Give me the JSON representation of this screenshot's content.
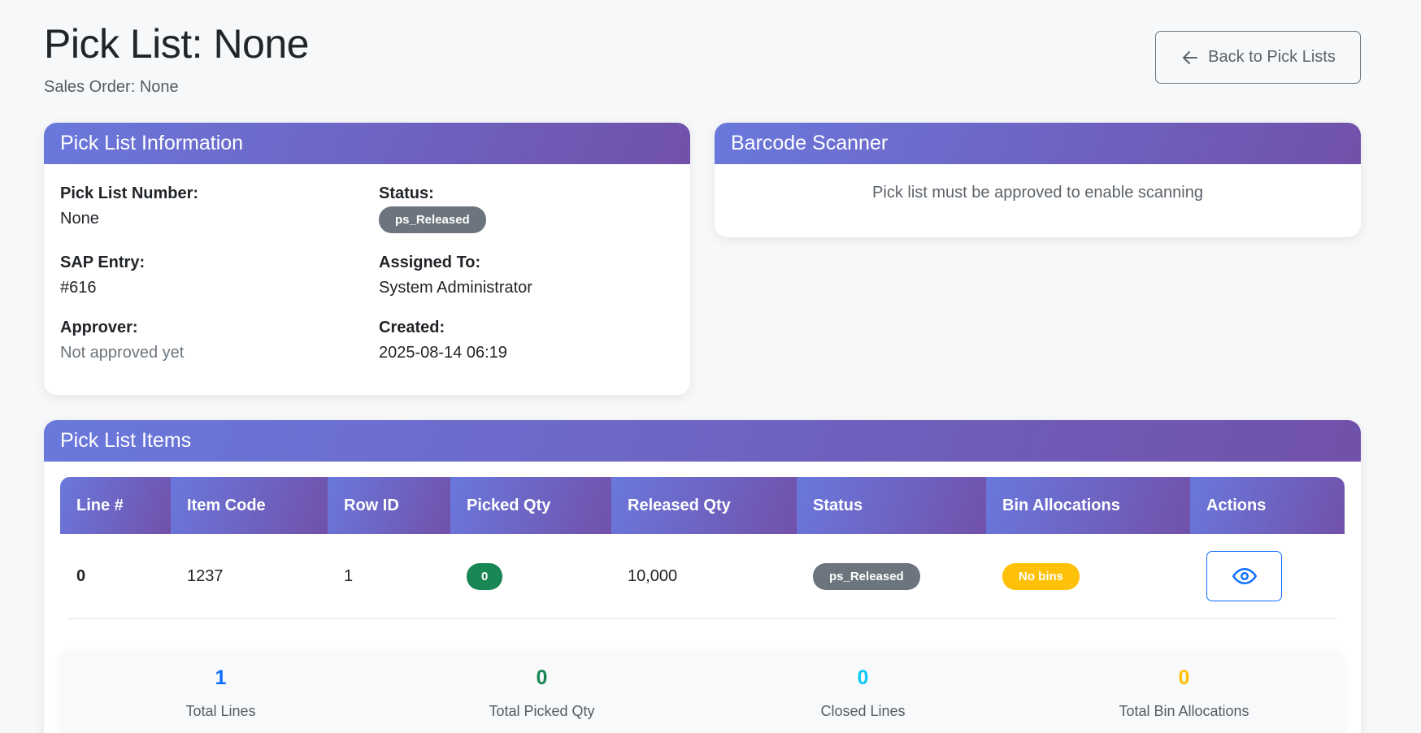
{
  "header": {
    "title": "Pick List: None",
    "subtitle": "Sales Order: None",
    "back_label": "Back to Pick Lists"
  },
  "info_card": {
    "title": "Pick List Information",
    "fields": {
      "pick_list_number": {
        "label": "Pick List Number:",
        "value": "None"
      },
      "status": {
        "label": "Status:",
        "value": "ps_Released"
      },
      "sap_entry": {
        "label": "SAP Entry:",
        "value": "#616"
      },
      "assigned_to": {
        "label": "Assigned To:",
        "value": "System Administrator"
      },
      "approver": {
        "label": "Approver:",
        "value": "Not approved yet"
      },
      "created": {
        "label": "Created:",
        "value": "2025-08-14 06:19"
      }
    }
  },
  "scanner_card": {
    "title": "Barcode Scanner",
    "message": "Pick list must be approved to enable scanning"
  },
  "items_card": {
    "title": "Pick List Items",
    "columns": [
      "Line #",
      "Item Code",
      "Row ID",
      "Picked Qty",
      "Released Qty",
      "Status",
      "Bin Allocations",
      "Actions"
    ],
    "rows": [
      {
        "line": "0",
        "item_code": "1237",
        "row_id": "1",
        "picked_qty": "0",
        "released_qty": "10,000",
        "status": "ps_Released",
        "bins": "No bins",
        "action_icon": "eye-icon"
      }
    ]
  },
  "summary": [
    {
      "value": "1",
      "label": "Total Lines",
      "color": "#0d6efd"
    },
    {
      "value": "0",
      "label": "Total Picked Qty",
      "color": "#198754"
    },
    {
      "value": "0",
      "label": "Closed Lines",
      "color": "#0dcaf0"
    },
    {
      "value": "0",
      "label": "Total Bin Allocations",
      "color": "#ffc107"
    }
  ],
  "colors": {
    "header_gradient_start": "#6a78dc",
    "header_gradient_end": "#7151aa",
    "badge_secondary": "#6c757d",
    "badge_success": "#198754",
    "badge_warning": "#ffc107"
  }
}
